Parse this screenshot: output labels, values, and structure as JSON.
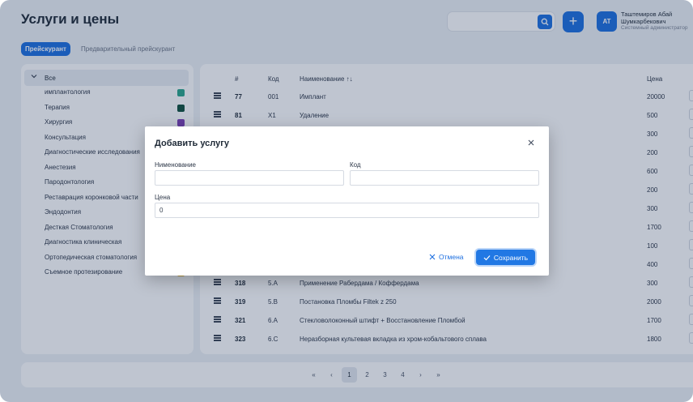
{
  "page": {
    "title": "Услуги и цены"
  },
  "header": {
    "search_placeholder": "",
    "add_label": "+",
    "user": {
      "initials": "AT",
      "name": "Таштемиров Абай Шумкарбекович",
      "role": "Системный администратор"
    }
  },
  "tabs": [
    {
      "label": "Прейскурант",
      "active": true
    },
    {
      "label": "Предварительный прейскурант",
      "active": false
    }
  ],
  "sidebar": {
    "all_label": "Все",
    "items": [
      {
        "label": "имплантология",
        "color": "#2aa58b"
      },
      {
        "label": "Терапия",
        "color": "#0f4f3c"
      },
      {
        "label": "Хирургия",
        "color": "#7b3fb5"
      },
      {
        "label": "Консультация",
        "color": ""
      },
      {
        "label": "Диагностические исследования",
        "color": ""
      },
      {
        "label": "Анестезия",
        "color": ""
      },
      {
        "label": "Пародонтология",
        "color": ""
      },
      {
        "label": "Реставрация коронковой части",
        "color": ""
      },
      {
        "label": "Эндодонтия",
        "color": ""
      },
      {
        "label": "Десткая Стоматология",
        "color": ""
      },
      {
        "label": "Диагностика клиническая",
        "color": ""
      },
      {
        "label": "Ортопедическая стоматология",
        "color": ""
      },
      {
        "label": "Съемное протезирование",
        "color": "#e8b93a"
      }
    ]
  },
  "table": {
    "headers": {
      "num": "#",
      "code": "Код",
      "name": "Наименование ↑↓",
      "price": "Цена"
    },
    "rows": [
      {
        "num": "77",
        "code": "001",
        "name": "Имплант",
        "price": "20000"
      },
      {
        "num": "81",
        "code": "X1",
        "name": "Удаление",
        "price": "500"
      },
      {
        "num": "",
        "code": "",
        "name": "",
        "price": "300"
      },
      {
        "num": "",
        "code": "",
        "name": "",
        "price": "200"
      },
      {
        "num": "",
        "code": "",
        "name": "",
        "price": "600"
      },
      {
        "num": "",
        "code": "",
        "name": "",
        "price": "200"
      },
      {
        "num": "",
        "code": "",
        "name": "",
        "price": "300"
      },
      {
        "num": "",
        "code": "",
        "name": "",
        "price": "1700"
      },
      {
        "num": "",
        "code": "",
        "name": "",
        "price": "100"
      },
      {
        "num": "",
        "code": "",
        "name": "",
        "price": "400"
      },
      {
        "num": "318",
        "code": "5.A",
        "name": "Применение Рабердама / Коффердама",
        "price": "300"
      },
      {
        "num": "319",
        "code": "5.B",
        "name": "Постановка Пломбы Filtek z 250",
        "price": "2000"
      },
      {
        "num": "321",
        "code": "6.A",
        "name": "Стекловолоконный штифт + Восстановление Пломбой",
        "price": "1700"
      },
      {
        "num": "323",
        "code": "6.C",
        "name": "Неразборная культевая вкладка из хром-кобальтового сплава",
        "price": "1800"
      }
    ]
  },
  "pagination": {
    "first": "«",
    "prev": "‹",
    "pages": [
      "1",
      "2",
      "3",
      "4"
    ],
    "current": "1",
    "next": "›",
    "last": "»"
  },
  "modal": {
    "title": "Добавить услугу",
    "name_label": "Нименование",
    "name_value": "",
    "code_label": "Код",
    "code_value": "",
    "price_label": "Цена",
    "price_value": "0",
    "cancel_label": "Отмена",
    "save_label": "Сохранить"
  }
}
